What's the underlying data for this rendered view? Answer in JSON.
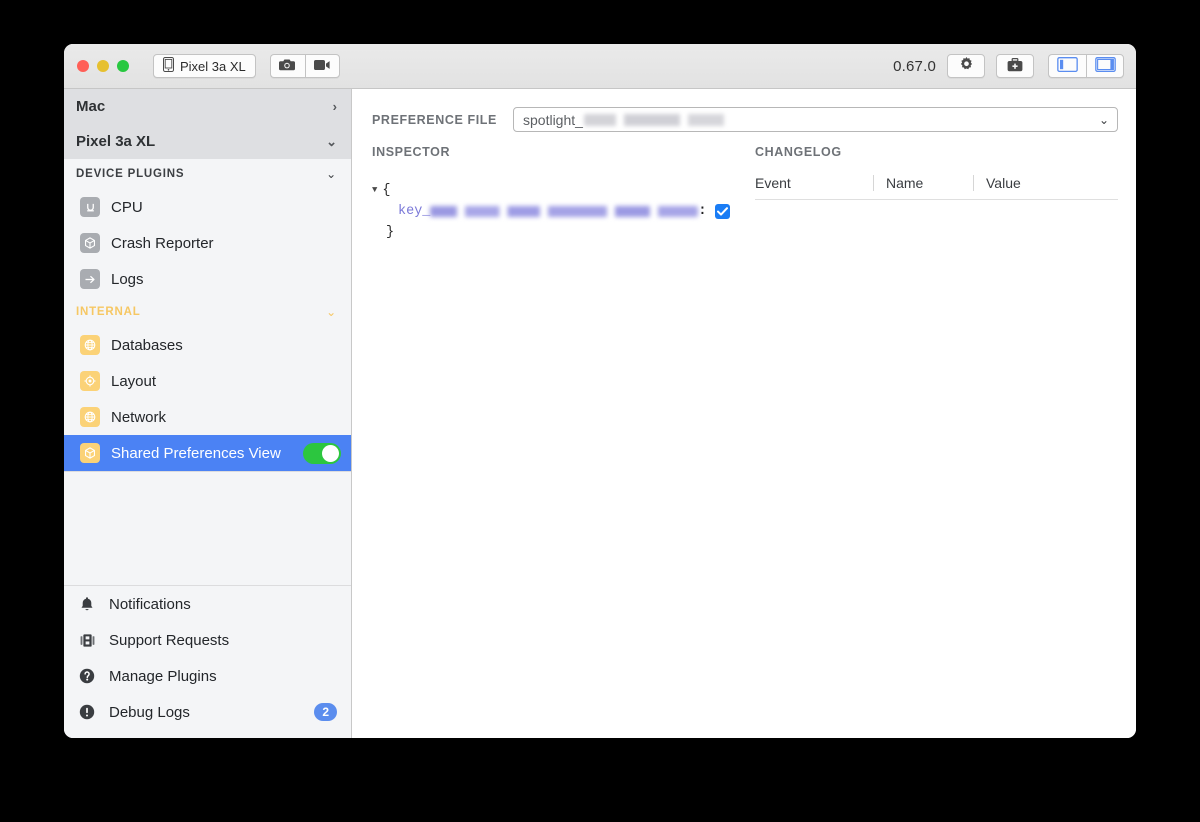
{
  "titlebar": {
    "device_button_label": "Pixel 3a XL",
    "device_icon": "phone-icon",
    "screenshot_icon": "camera-icon",
    "record_icon": "video-camera-icon",
    "version": "0.67.0",
    "settings_icon": "gear-icon",
    "doctor_icon": "medkit-icon",
    "left_panel_icon": "left-sidebar-layout-icon",
    "right_panel_icon": "right-sidebar-layout-icon"
  },
  "sidebar": {
    "devices": [
      {
        "label": "Mac",
        "chevron": "›",
        "expanded": false
      },
      {
        "label": "Pixel 3a XL",
        "chevron": "⌄",
        "expanded": true
      }
    ],
    "device_plugins": {
      "title": "DEVICE PLUGINS",
      "chevron": "⌄",
      "items": [
        {
          "label": "CPU",
          "icon": "cpu-icon"
        },
        {
          "label": "Crash Reporter",
          "icon": "cube-icon"
        },
        {
          "label": "Logs",
          "icon": "arrow-right-icon"
        }
      ]
    },
    "internal": {
      "title": "INTERNAL",
      "chevron": "⌄",
      "items": [
        {
          "label": "Databases",
          "icon": "globe-icon",
          "selected": false
        },
        {
          "label": "Layout",
          "icon": "target-icon",
          "selected": false
        },
        {
          "label": "Network",
          "icon": "globe-icon",
          "selected": false
        },
        {
          "label": "Shared Preferences View",
          "icon": "cube-icon",
          "selected": true,
          "toggle": "on"
        }
      ]
    },
    "bottom_items": [
      {
        "label": "Notifications",
        "icon": "bell-icon"
      },
      {
        "label": "Support Requests",
        "icon": "support-icon"
      },
      {
        "label": "Manage Plugins",
        "icon": "question-circle-icon"
      },
      {
        "label": "Debug Logs",
        "icon": "exclamation-circle-icon",
        "badge": "2"
      }
    ]
  },
  "main": {
    "preference_file_label": "PREFERENCE FILE",
    "preference_file_value": "spotlight_",
    "preference_file_chevron": "⌄",
    "inspector_label": "INSPECTOR",
    "changelog_label": "CHANGELOG",
    "json": {
      "open_brace": "{",
      "close_brace": "}",
      "triangle": "▼",
      "key_prefix": "key_",
      "colon": ":",
      "value_checkbox": "checked"
    },
    "changelog_columns": [
      "Event",
      "Name",
      "Value"
    ],
    "changelog_rows": []
  },
  "colors": {
    "accent_blue": "#4b82f4",
    "toggle_green": "#2cc63f",
    "internal_gold": "#f6c763",
    "plugin_icon_yellow": "#fbd277",
    "badge_blue": "#5b8dee",
    "json_key_purple": "#7a78d8"
  }
}
